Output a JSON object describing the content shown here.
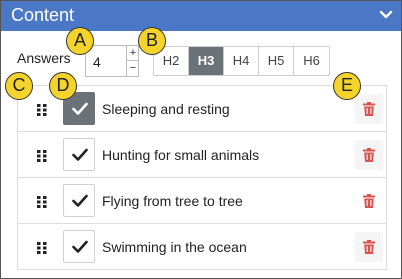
{
  "header": {
    "title": "Content",
    "chevron_icon": "chevron-down-icon"
  },
  "answers": {
    "label": "Answers",
    "value": "4",
    "increment": "+",
    "decrement": "−"
  },
  "headings": [
    {
      "label": "H2",
      "active": false
    },
    {
      "label": "H3",
      "active": true
    },
    {
      "label": "H4",
      "active": false
    },
    {
      "label": "H5",
      "active": false
    },
    {
      "label": "H6",
      "active": false
    }
  ],
  "items": [
    {
      "label": "Sleeping and resting",
      "checked_style": "active"
    },
    {
      "label": "Hunting for small animals",
      "checked_style": "normal"
    },
    {
      "label": "Flying from tree to tree",
      "checked_style": "normal"
    },
    {
      "label": "Swimming in the ocean",
      "checked_style": "normal"
    }
  ],
  "callouts": {
    "a": "A",
    "b": "B",
    "c": "C",
    "d": "D",
    "e": "E"
  },
  "colors": {
    "header_bg": "#4a78c7",
    "active_button": "#6b7379",
    "trash_red": "#d9534f",
    "callout_yellow": "#f4d42a"
  }
}
